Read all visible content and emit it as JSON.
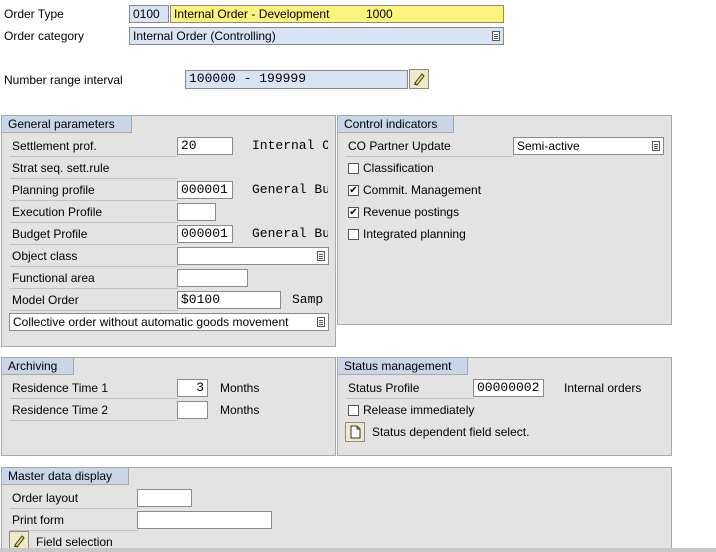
{
  "header": {
    "order_type_label": "Order Type",
    "order_type_code": "0100",
    "order_type_desc": "Internal Order - Development",
    "order_type_num": "1000",
    "order_category_label": "Order category",
    "order_category_value": "Internal Order (Controlling)",
    "number_range_label": "Number range interval",
    "number_range_value": "100000 - 199999"
  },
  "general": {
    "title": "General parameters",
    "settlement_label": "Settlement prof.",
    "settlement_value": "20",
    "settlement_desc": "Internal O",
    "strat_label": "Strat seq. sett.rule",
    "planning_label": "Planning profile",
    "planning_value": "000001",
    "planning_desc": "General Bu",
    "execution_label": "Execution Profile",
    "execution_value": "",
    "budget_label": "Budget Profile",
    "budget_value": "000001",
    "budget_desc": "General Bu",
    "object_class_label": "Object class",
    "object_class_value": "",
    "functional_label": "Functional area",
    "functional_value": "",
    "model_label": "Model Order",
    "model_value": "$0100",
    "model_desc": "Samp",
    "collective_value": "Collective order without automatic goods movement"
  },
  "control": {
    "title": "Control indicators",
    "co_partner_label": "CO Partner Update",
    "co_partner_value": "Semi-active",
    "classification_label": "Classification",
    "classification_checked": false,
    "commit_label": "Commit. Management",
    "commit_checked": true,
    "revenue_label": "Revenue postings",
    "revenue_checked": true,
    "integrated_label": "Integrated planning",
    "integrated_checked": false
  },
  "archiving": {
    "title": "Archiving",
    "res1_label": "Residence Time 1",
    "res1_value": "3",
    "res1_unit": "Months",
    "res2_label": "Residence Time 2",
    "res2_value": "",
    "res2_unit": "Months"
  },
  "status": {
    "title": "Status management",
    "profile_label": "Status Profile",
    "profile_value": "00000002",
    "profile_desc": "Internal orders",
    "release_label": "Release immediately",
    "release_checked": false,
    "field_select_label": "Status dependent field select."
  },
  "master": {
    "title": "Master data display",
    "layout_label": "Order layout",
    "layout_value": "",
    "print_label": "Print form",
    "print_value": "",
    "field_selection_label": "Field selection"
  },
  "colors": {
    "group_bg": "#e3e3e3",
    "group_title_bg": "#c9d6e8",
    "highlight_yellow": "#fbf37d",
    "blue_field": "#d8e3f4"
  }
}
